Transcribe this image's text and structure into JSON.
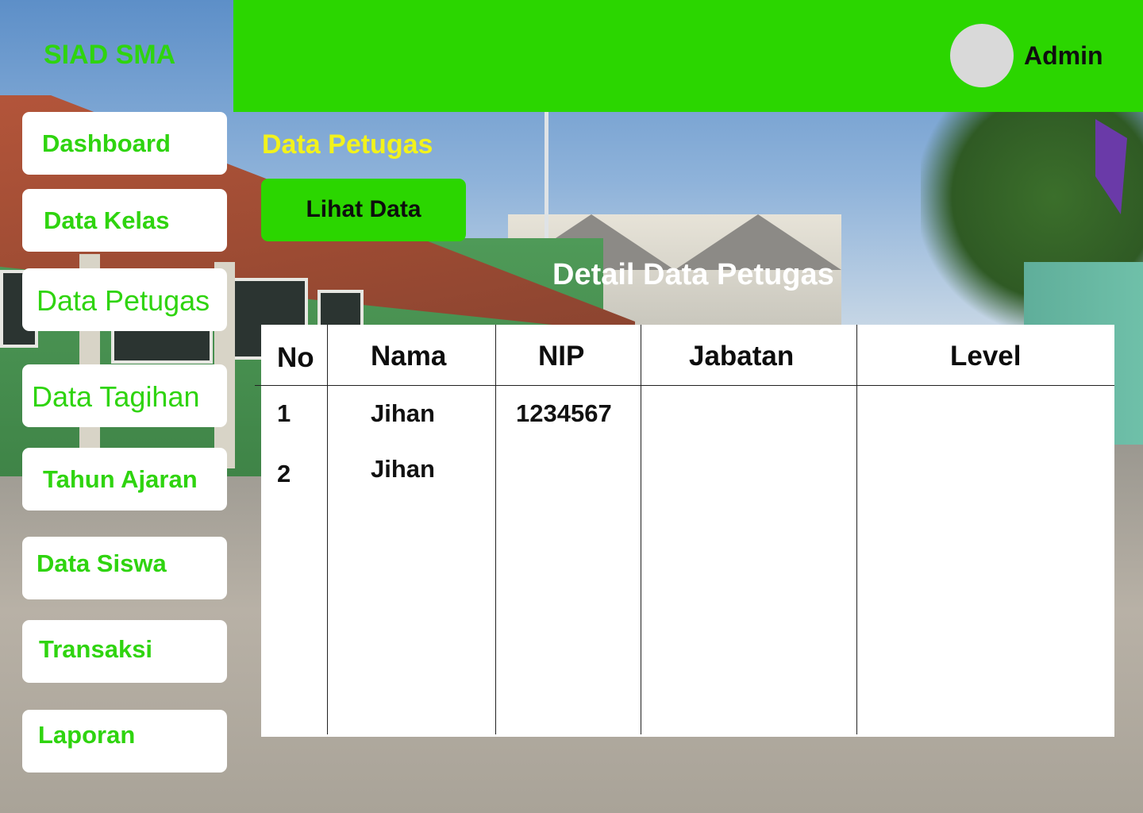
{
  "app": {
    "brand": "SIAD SMA"
  },
  "header": {
    "user_name": "Admin",
    "avatar_icon": "avatar-placeholder"
  },
  "sidebar": {
    "items": [
      {
        "label": "Dashboard"
      },
      {
        "label": "Data Kelas"
      },
      {
        "label": "Data Petugas"
      },
      {
        "label": "Data Tagihan"
      },
      {
        "label": "Tahun Ajaran"
      },
      {
        "label": "Data Siswa"
      },
      {
        "label": "Transaksi"
      },
      {
        "label": "Laporan"
      }
    ]
  },
  "main": {
    "title": "Data Petugas",
    "view_button": "Lihat  Data",
    "table_title": "Detail Data Petugas",
    "table": {
      "columns": [
        "No",
        "Nama",
        "NIP",
        "Jabatan",
        "Level"
      ],
      "rows": [
        [
          "1",
          "Jihan",
          "1234567",
          "",
          ""
        ],
        [
          "2",
          "Jihan",
          "",
          "",
          ""
        ]
      ]
    }
  },
  "colors": {
    "accent": "#2bd600",
    "title_yellow": "#f2f21c",
    "panel": "#ffffff"
  }
}
